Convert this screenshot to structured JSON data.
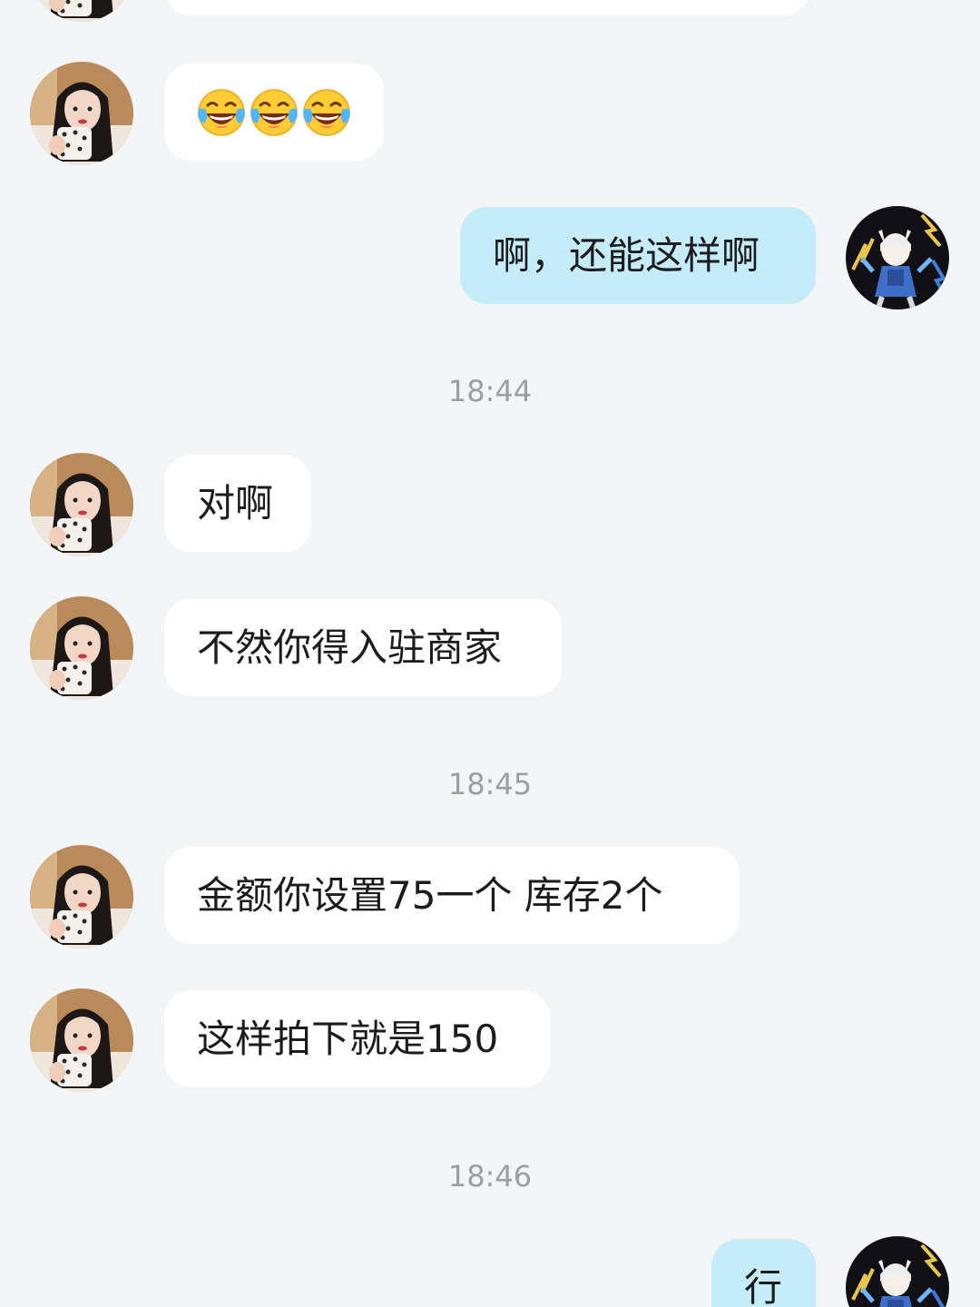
{
  "messages": {
    "m1": {
      "sender": "contact",
      "emoji": [
        "emoji-laugh-tears",
        "emoji-laugh-tears",
        "emoji-laugh-tears"
      ]
    },
    "m2": {
      "sender": "me",
      "text": "啊，还能这样啊"
    },
    "t1": "18:44",
    "m3": {
      "sender": "contact",
      "text": "对啊"
    },
    "m4": {
      "sender": "contact",
      "text": "不然你得入驻商家"
    },
    "t2": "18:45",
    "m5": {
      "sender": "contact",
      "text": "金额你设置75一个 库存2个"
    },
    "m6": {
      "sender": "contact",
      "text": "这样拍下就是150"
    },
    "t3": "18:46",
    "m7": {
      "sender": "me",
      "text": "行"
    }
  },
  "colors": {
    "background": "#f4f5f7",
    "incoming_bubble": "#ffffff",
    "outgoing_bubble": "#c5ecf9",
    "timestamp": "#9a9ea6"
  }
}
